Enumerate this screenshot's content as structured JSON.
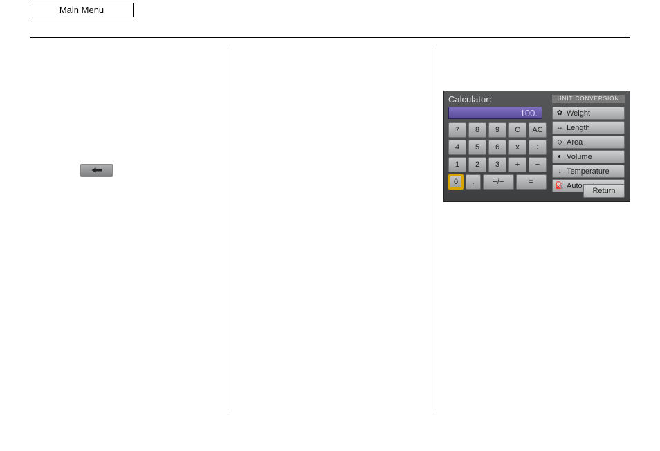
{
  "header": {
    "main_menu": "Main Menu"
  },
  "calc": {
    "title": "Calculator:",
    "display": "100.",
    "rows": [
      [
        "7",
        "8",
        "9",
        "C",
        "AC"
      ],
      [
        "4",
        "5",
        "6",
        "x",
        "÷"
      ],
      [
        "1",
        "2",
        "3",
        "+",
        "−"
      ],
      [
        "0",
        ".",
        "+/−",
        "="
      ]
    ],
    "selected_key": "0",
    "unit_header": "UNIT CONVERSION",
    "units": [
      {
        "icon": "✿",
        "label": "Weight"
      },
      {
        "icon": "↔",
        "label": "Length"
      },
      {
        "icon": "◇",
        "label": "Area"
      },
      {
        "icon": "◐",
        "label": "Volume"
      },
      {
        "icon": "↓",
        "label": "Temperature"
      },
      {
        "icon": "⛽",
        "label": "Automotive"
      }
    ],
    "return": "Return"
  }
}
